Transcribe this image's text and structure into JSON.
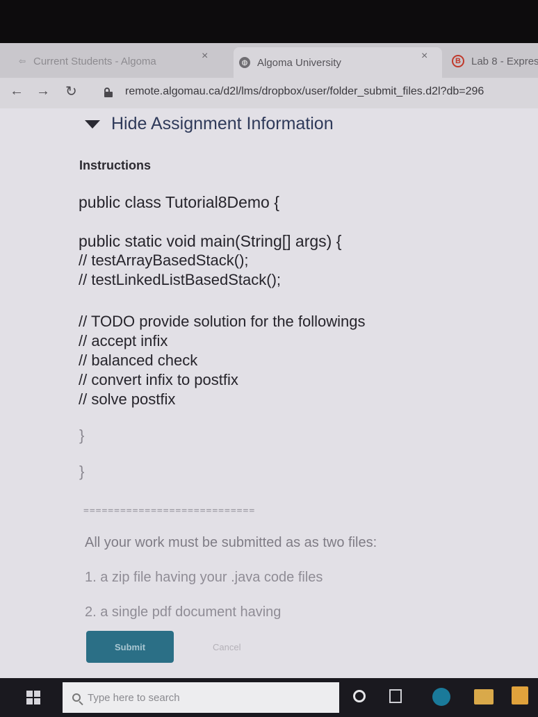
{
  "browser": {
    "tabs": [
      {
        "title": "Current Students - Algoma",
        "icon": "arrow-icon"
      },
      {
        "title": "Algoma University",
        "icon": "globe-icon"
      },
      {
        "title": "Lab 8 - Expres",
        "icon": "b-icon"
      }
    ],
    "close_glyph": "×",
    "url": "remote.algomau.ca/d2l/lms/dropbox/user/folder_submit_files.d2l?db=296"
  },
  "assignment": {
    "hide_label": "Hide Assignment Information",
    "instructions_label": "Instructions",
    "code_lines": {
      "class_decl": "public class Tutorial8Demo {",
      "main_decl": "public static void main(String[] args) {",
      "call1": "// testArrayBasedStack();",
      "call2": "// testLinkedListBasedStack();",
      "todo": "// TODO provide solution for the followings",
      "item1": "// accept infix",
      "item2": "// balanced check",
      "item3": "// convert infix to postfix",
      "item4": "// solve postfix",
      "close1": "}",
      "close2": "}"
    },
    "rule": "============================",
    "notes": {
      "line1": "All your work must be submitted as as two files:",
      "line2": "1. a zip file having your .java code files",
      "line3": "2. a single pdf document having"
    },
    "submit_label": "Submit",
    "cancel_label": "Cancel"
  },
  "taskbar": {
    "search_placeholder": "Type here to search"
  }
}
